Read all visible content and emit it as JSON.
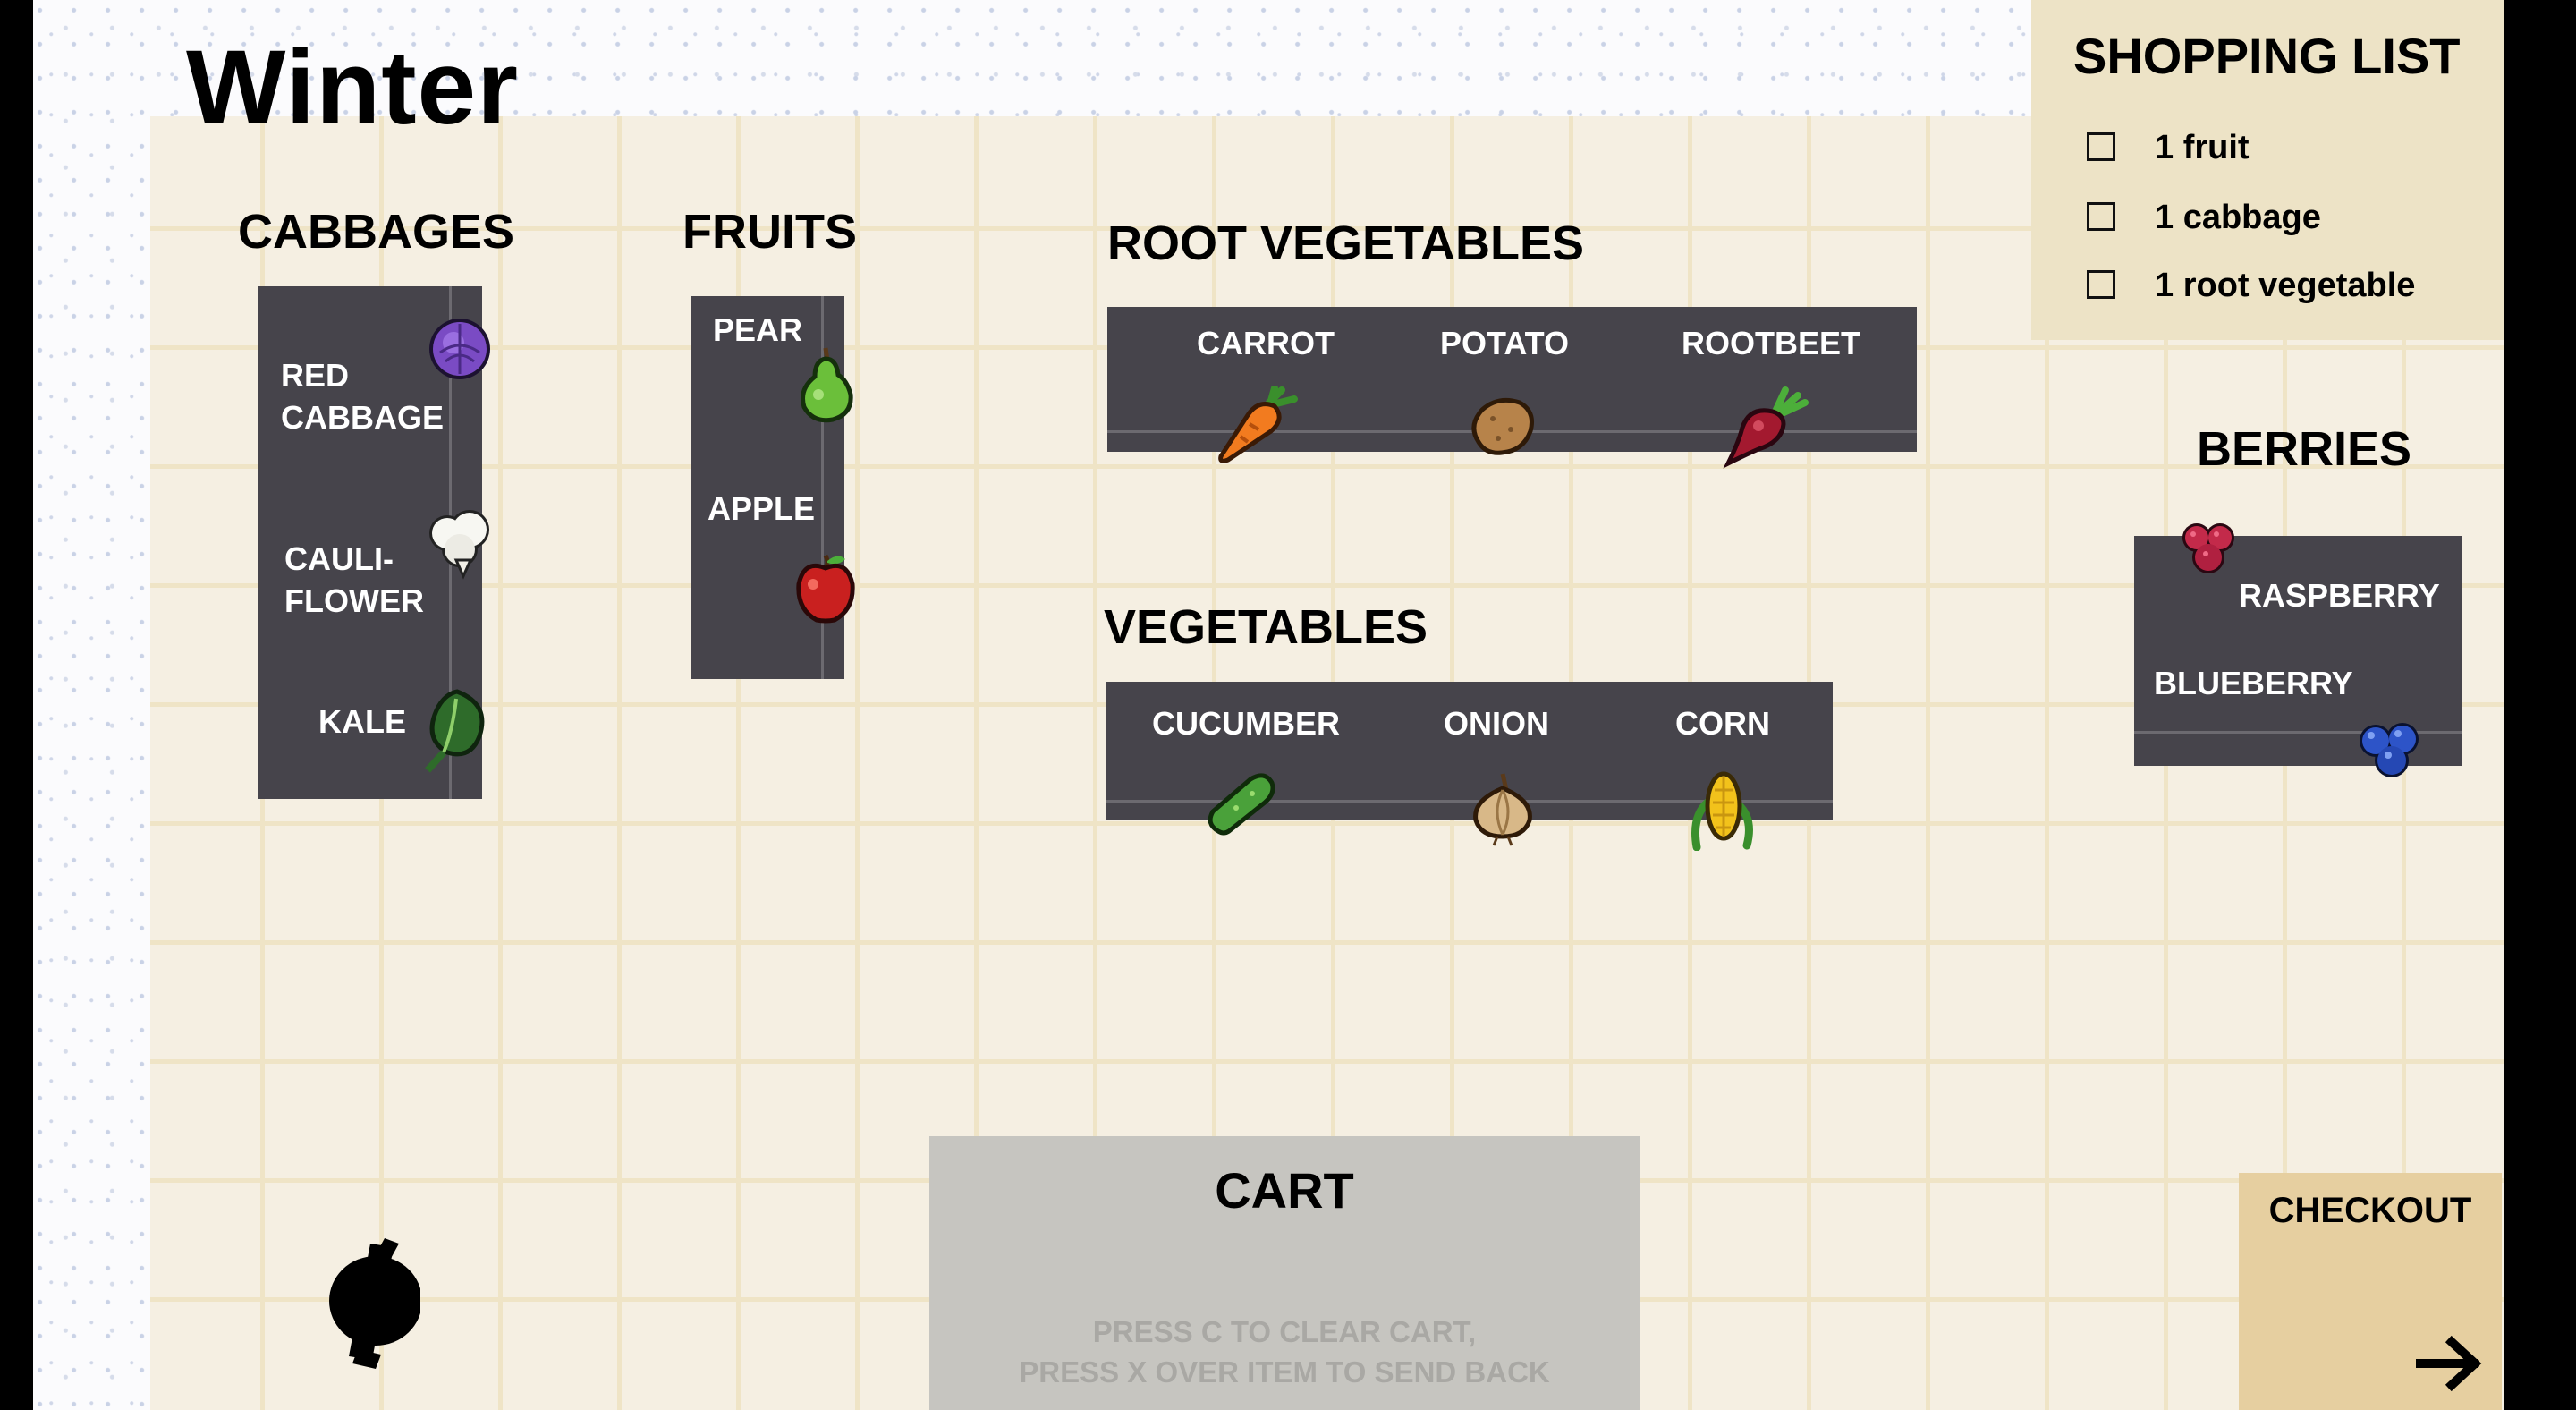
{
  "level_title": "Winter",
  "sections": {
    "cabbages": {
      "heading": "CABBAGES",
      "items": [
        "RED\nCABBAGE",
        "CAULI-\nFLOWER",
        "KALE"
      ]
    },
    "fruits": {
      "heading": "FRUITS",
      "items": [
        "PEAR",
        "APPLE"
      ]
    },
    "root_vegetables": {
      "heading": "ROOT VEGETABLES",
      "items": [
        "CARROT",
        "POTATO",
        "ROOTBEET"
      ]
    },
    "vegetables": {
      "heading": "VEGETABLES",
      "items": [
        "CUCUMBER",
        "ONION",
        "CORN"
      ]
    },
    "berries": {
      "heading": "BERRIES",
      "items": [
        "RASPBERRY",
        "BLUEBERRY"
      ]
    }
  },
  "shopping_list": {
    "title": "SHOPPING LIST",
    "items": [
      {
        "text": "1 fruit",
        "checked": false
      },
      {
        "text": "1 cabbage",
        "checked": false
      },
      {
        "text": "1 root vegetable",
        "checked": false
      }
    ]
  },
  "cart": {
    "title": "CART",
    "hint_line1": "PRESS C TO CLEAR CART,",
    "hint_line2": "PRESS X OVER ITEM TO SEND BACK"
  },
  "checkout": {
    "label": "CHECKOUT"
  },
  "colors": {
    "shelf": "#46444b",
    "floor": "#f5efe2",
    "list_panel": "#ede3c6",
    "cart": "#c6c5c0",
    "checkout": "#e6cfa0"
  },
  "icons": {
    "red_cabbage": "red-cabbage-icon",
    "cauliflower": "cauliflower-icon",
    "kale": "kale-icon",
    "pear": "pear-icon",
    "apple": "apple-icon",
    "carrot": "carrot-icon",
    "potato": "potato-icon",
    "rootbeet": "beet-icon",
    "cucumber": "cucumber-icon",
    "onion": "onion-icon",
    "corn": "corn-icon",
    "raspberry": "raspberry-icon",
    "blueberry": "blueberry-icon",
    "checkout_arrow": "arrow-right-icon",
    "player": "player-icon"
  }
}
